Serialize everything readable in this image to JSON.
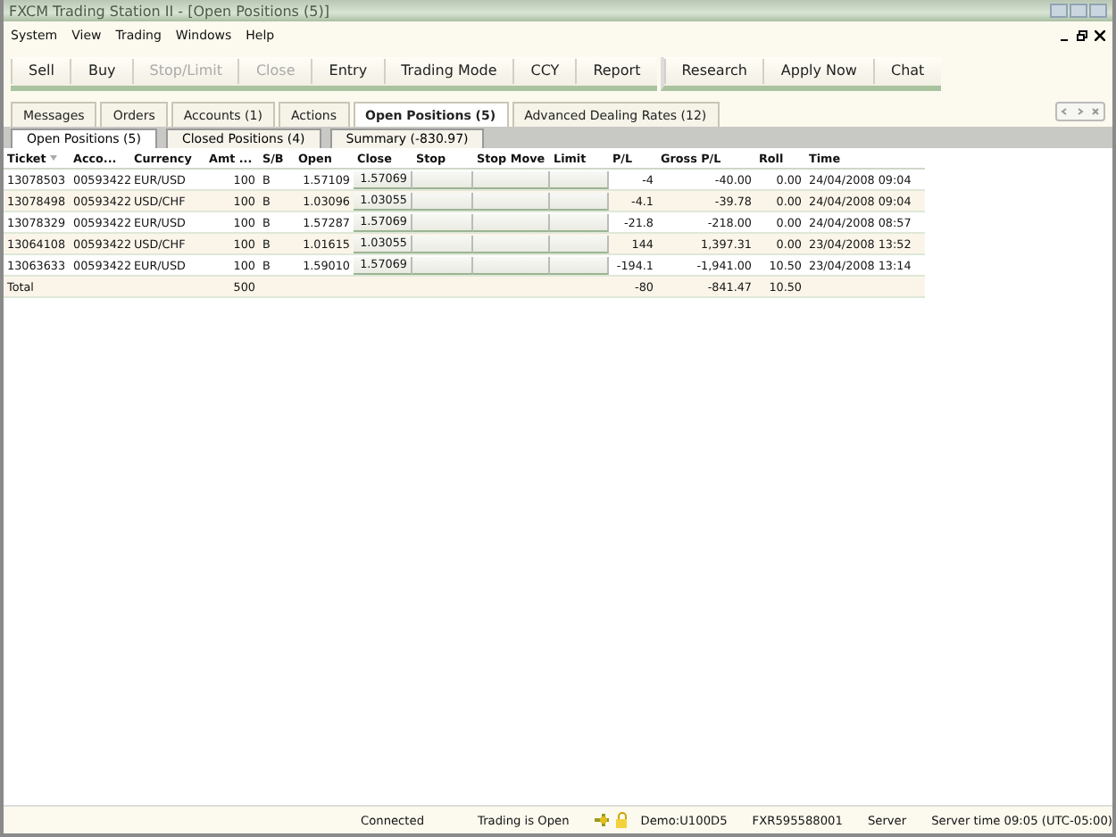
{
  "window": {
    "title": "FXCM Trading Station II - [Open Positions (5)]"
  },
  "menu": [
    "System",
    "View",
    "Trading",
    "Windows",
    "Help"
  ],
  "toolbar": [
    [
      {
        "label": "Sell",
        "disabled": false
      },
      {
        "label": "Buy",
        "disabled": false
      },
      {
        "label": "Stop/Limit",
        "disabled": true
      },
      {
        "label": "Close",
        "disabled": true
      },
      {
        "label": "Entry",
        "disabled": false
      },
      {
        "label": "Trading Mode",
        "disabled": false
      },
      {
        "label": "CCY",
        "disabled": false
      },
      {
        "label": "Report",
        "disabled": false
      }
    ],
    [
      {
        "label": "Research",
        "disabled": false
      },
      {
        "label": "Apply Now",
        "disabled": false
      },
      {
        "label": "Chat",
        "disabled": false
      }
    ]
  ],
  "tabs": [
    {
      "label": "Messages",
      "selected": false
    },
    {
      "label": "Orders",
      "selected": false
    },
    {
      "label": "Accounts (1)",
      "selected": false
    },
    {
      "label": "Actions",
      "selected": false
    },
    {
      "label": "Open Positions (5)",
      "selected": true
    },
    {
      "label": "Advanced Dealing Rates (12)",
      "selected": false
    }
  ],
  "subtabs": [
    {
      "label": "Open Positions (5)",
      "selected": true
    },
    {
      "label": "Closed Positions (4)",
      "selected": false
    },
    {
      "label": "Summary (-830.97)",
      "selected": false
    }
  ],
  "table": {
    "columns": [
      "Ticket",
      "Acco...",
      "Currency",
      "Amt ...",
      "S/B",
      "Open",
      "Close",
      "Stop",
      "Stop Move",
      "Limit",
      "P/L",
      "Gross P/L",
      "Roll",
      "Time"
    ],
    "rows": [
      {
        "ticket": "13078503",
        "account": "00593422",
        "currency": "EUR/USD",
        "amount": "100",
        "side": "B",
        "open": "1.57109",
        "close": "1.57069",
        "pl": "-4",
        "gross_pl": "-40.00",
        "roll": "0.00",
        "time": "24/04/2008 09:04"
      },
      {
        "ticket": "13078498",
        "account": "00593422",
        "currency": "USD/CHF",
        "amount": "100",
        "side": "B",
        "open": "1.03096",
        "close": "1.03055",
        "pl": "-4.1",
        "gross_pl": "-39.78",
        "roll": "0.00",
        "time": "24/04/2008 09:04"
      },
      {
        "ticket": "13078329",
        "account": "00593422",
        "currency": "EUR/USD",
        "amount": "100",
        "side": "B",
        "open": "1.57287",
        "close": "1.57069",
        "pl": "-21.8",
        "gross_pl": "-218.00",
        "roll": "0.00",
        "time": "24/04/2008 08:57"
      },
      {
        "ticket": "13064108",
        "account": "00593422",
        "currency": "USD/CHF",
        "amount": "100",
        "side": "B",
        "open": "1.01615",
        "close": "1.03055",
        "pl": "144",
        "gross_pl": "1,397.31",
        "roll": "0.00",
        "time": "23/04/2008 13:52"
      },
      {
        "ticket": "13063633",
        "account": "00593422",
        "currency": "EUR/USD",
        "amount": "100",
        "side": "B",
        "open": "1.59010",
        "close": "1.57069",
        "pl": "-194.1",
        "gross_pl": "-1,941.00",
        "roll": "10.50",
        "time": "23/04/2008 13:14"
      }
    ],
    "total": {
      "label": "Total",
      "amount": "500",
      "pl": "-80",
      "gross_pl": "-841.47",
      "roll": "10.50"
    }
  },
  "status_bar": [
    "Connected",
    "Trading is Open",
    "Demo:U100D5",
    "FXR595588001",
    "Server",
    "Server time 09:05 (UTC-05:00)"
  ]
}
